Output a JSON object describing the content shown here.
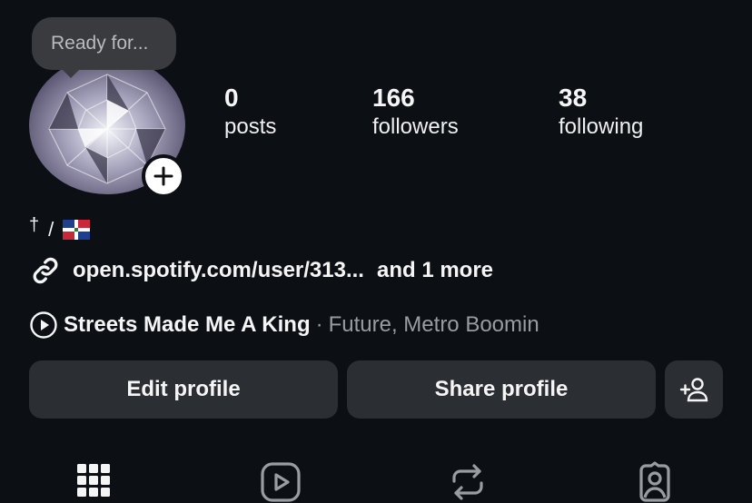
{
  "note_bubble": {
    "text": "Ready for..."
  },
  "stats": [
    {
      "value": "0",
      "label": "posts"
    },
    {
      "value": "166",
      "label": "followers"
    },
    {
      "value": "38",
      "label": "following"
    }
  ],
  "bio": {
    "cross": "†",
    "slash": "/",
    "flag_icon": "dominican-republic-flag"
  },
  "link": {
    "url": "open.spotify.com/user/313...",
    "more": "and 1 more",
    "icon": "link-icon"
  },
  "music": {
    "song": "Streets Made Me A King",
    "separator": "·",
    "artists": "Future, Metro Boomin",
    "icon": "play-circle-icon"
  },
  "buttons": {
    "edit_profile": "Edit profile",
    "share_profile": "Share profile",
    "discover_icon": "add-person-icon"
  },
  "tabs": [
    {
      "name": "grid-icon"
    },
    {
      "name": "reels-icon"
    },
    {
      "name": "reposts-icon"
    },
    {
      "name": "tagged-icon"
    }
  ],
  "colors": {
    "background": "#0c0f14",
    "button": "#2b2e33",
    "muted_text": "#9a9ca1",
    "bubble": "#3a3b3f"
  }
}
